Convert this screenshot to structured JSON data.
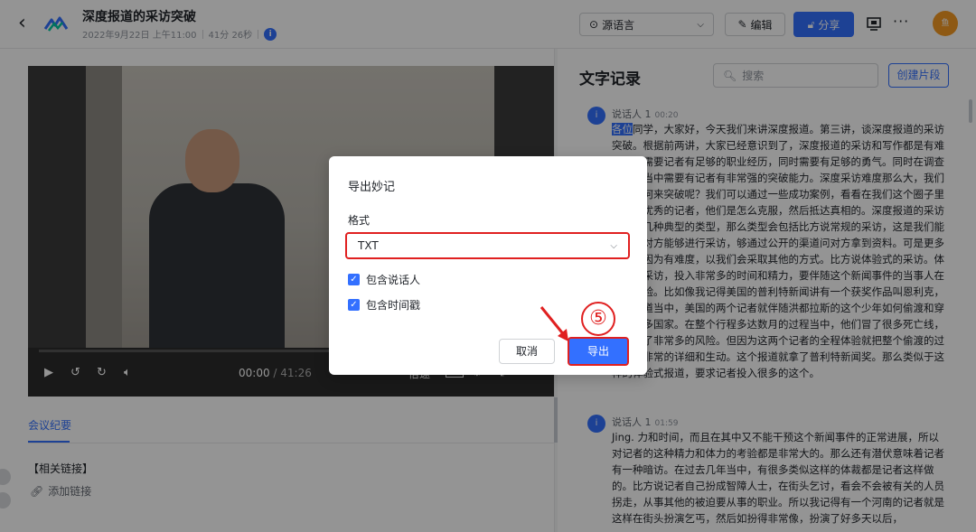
{
  "header": {
    "title": "深度报道的采访突破",
    "date": "2022年9月22日 上午11:00",
    "duration": "41分 26秒",
    "info_glyph": "i",
    "lang_select": "源语言",
    "edit_label": "编辑",
    "share_label": "分享",
    "avatar_text": "鱼"
  },
  "player": {
    "current_time": "00:00",
    "total_time": "/ 41:26",
    "speed_label": "倍速"
  },
  "left_panel": {
    "tab_minutes": "会议纪要",
    "links_title": "【相关链接】",
    "add_link": "添加链接"
  },
  "transcript": {
    "title": "文字记录",
    "search_placeholder": "搜索",
    "create_clip": "创建片段",
    "segments": [
      {
        "avatar": "i",
        "speaker": "说话人 1",
        "time": "00:20",
        "highlight": "各位",
        "text": "同学，大家好，今天我们来讲深度报道。第三讲，谈深度报道的采访突破。根据前两讲，大家已经意识到了，深度报道的采访和写作都是有难度的，需要记者有足够的职业经历，同时需要有足够的勇气。同时在调查和写作当中需要有记者有非常强的突破能力。深度采访难度那么大，我们应该如何来突破呢？我们可以通过一些成功案例，看看在我们这个圈子里面非常优秀的记者，他们是怎么克服，然后抵达真相的。深度报道的采访它会有几种典型的类型，那么类型会包括比方说常规的采访，这是我们能够约到对方能够进行采访，够通过公开的渠道问对方拿到资料。可是更多的采访因为有难度，以我们会采取其他的方式。比方说体验式的采访。体验式的采访，投入非常多的时间和精力，要伴随这个新闻事件的当事人在现场经验。比如像我记得美国的普利特新闻讲有一个获奖作品叫恩利克，这个报道当中，美国的两个记者就伴随洪都拉斯的这个少年如何偷渡和穿越了很多国家。在整个行程多达数月的过程当中，他们冒了很多死亡线，然后冒了非常多的风险。但因为这两个记者的全程体验就把整个偷渡的过程写得非常的详细和生动。这个报道就拿了普利特新闻奖。那么类似于这样的体验式报道，要求记者投入很多的这个。"
      },
      {
        "avatar": "i",
        "speaker": "说话人 1",
        "time": "01:59",
        "text": "Jing. 力和时间，而且在其中又不能干预这个新闻事件的正常进展，所以对记者的这种精力和体力的考验都是非常大的。那么还有潜伏意味着记者有一种暗访。在过去几年当中，有很多类似这样的体裁都是记者这样做的。比方说记者自己扮成智障人士，在街头乞讨，看会不会被有关的人员拐走，从事其他的被迫要从事的职业。所以我记得有一个河南的记者就是这样在街头扮演乞丐，然后如扮得非常像，扮演了好多天以后，"
      }
    ]
  },
  "dialog": {
    "title": "导出妙记",
    "format_label": "格式",
    "format_value": "TXT",
    "include_speaker": "包含说话人",
    "include_timestamp": "包含时间戳",
    "cancel_label": "取消",
    "export_label": "导出"
  },
  "annotation": {
    "step": "⑤",
    "color": "#e02020"
  }
}
